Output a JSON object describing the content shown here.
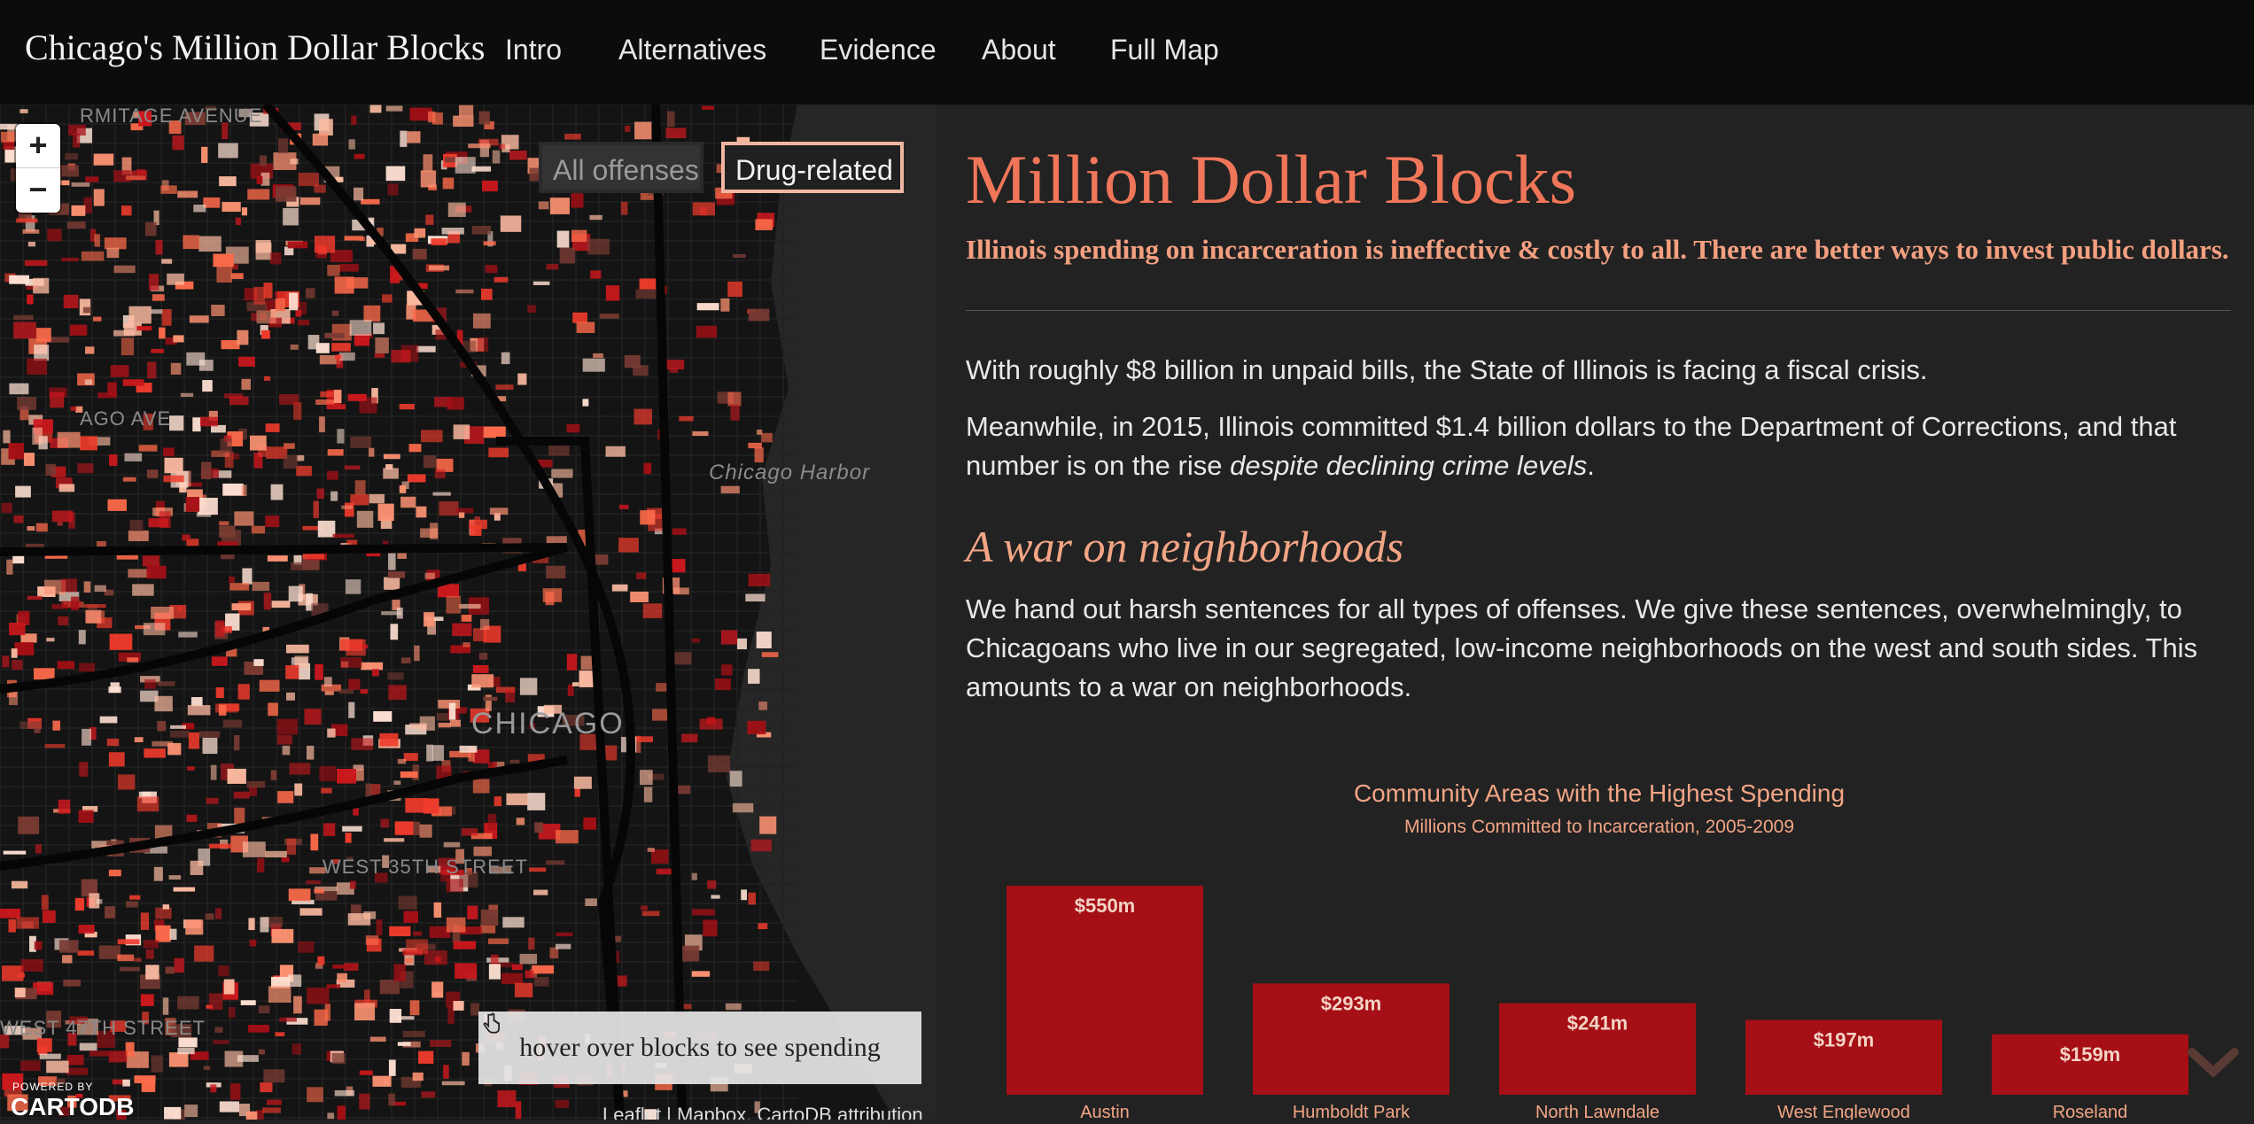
{
  "navbar": {
    "brand": "Chicago's Million Dollar Blocks",
    "items": [
      "Intro",
      "Alternatives",
      "Evidence",
      "About",
      "Full Map"
    ]
  },
  "map": {
    "zoom_in_label": "+",
    "zoom_out_label": "−",
    "toggle_all": "All offenses",
    "toggle_drug": "Drug-related",
    "hover_hint": "hover over blocks to see spending",
    "hover_icon": "pointer-hand-icon",
    "powered_by": "POWERED BY",
    "cartodb": "CARTODB",
    "attribution": "Leaflet | Mapbox, CartoDB attribution",
    "labels": {
      "chicago": "CHICAGO",
      "harbor": "Chicago Harbor",
      "street_35": "WEST 35TH STREET",
      "street_47": "WEST 47TH STREET",
      "ago_ave": "AGO AVE",
      "avenue_top": "RMITAGE AVENUE"
    }
  },
  "content": {
    "title": "Million Dollar Blocks",
    "subtitle": "Illinois spending on incarceration is ineffective & costly to all. There are better ways to invest public dollars.",
    "para1": "With roughly $8 billion in unpaid bills, the State of Illinois is facing a fiscal crisis.",
    "para2_main": "Meanwhile, in 2015, Illinois committed $1.4 billion dollars to the Department of Corrections, and that number is on the rise ",
    "para2_em": "despite declining crime levels",
    "para2_end": ".",
    "section_heading": "A war on neighborhoods",
    "para3": "We hand out harsh sentences for all types of offenses. We give these sentences, overwhelmingly, to Chicagoans who live in our segregated, low-income neighborhoods on the west and south sides. This amounts to a war on neighborhoods."
  },
  "colors": {
    "accent": "#f0765a",
    "bar": "#a50f15",
    "background": "#222222",
    "navbar": "#0c0c0c"
  },
  "chart_data": {
    "type": "bar",
    "title": "Community Areas with the Highest Spending",
    "subtitle": "Millions Committed to Incarceration, 2005-2009",
    "categories": [
      "Austin",
      "Humboldt Park",
      "North Lawndale",
      "West Englewood",
      "Roseland"
    ],
    "values": [
      550,
      293,
      241,
      197,
      159
    ],
    "labels": [
      "$550m",
      "$293m",
      "$241m",
      "$197m",
      "$159m"
    ],
    "ylim": [
      0,
      550
    ]
  }
}
